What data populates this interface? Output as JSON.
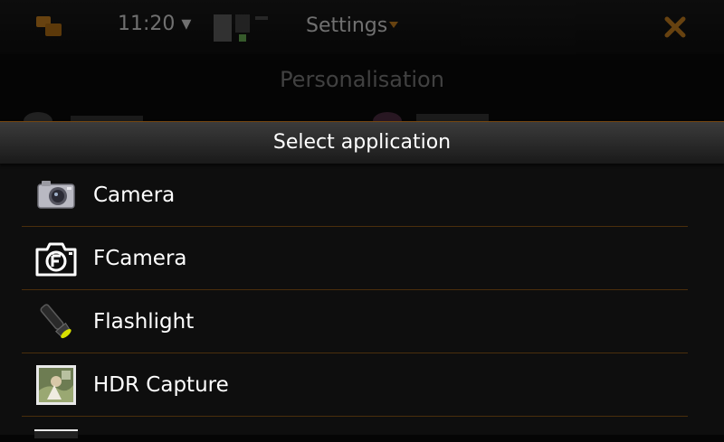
{
  "statusbar": {
    "time": "11:20 ▾",
    "title": "Settings"
  },
  "background": {
    "heading": "Personalisation"
  },
  "dialog": {
    "title": "Select application",
    "items": [
      {
        "label": "Camera",
        "icon": "camera-icon"
      },
      {
        "label": "FCamera",
        "icon": "fcamera-icon"
      },
      {
        "label": "Flashlight",
        "icon": "flashlight-icon"
      },
      {
        "label": "HDR Capture",
        "icon": "hdr-capture-icon"
      }
    ]
  },
  "colors": {
    "accent": "#b8741a",
    "separator": "#4a2e0c",
    "text": "#ffffff"
  }
}
